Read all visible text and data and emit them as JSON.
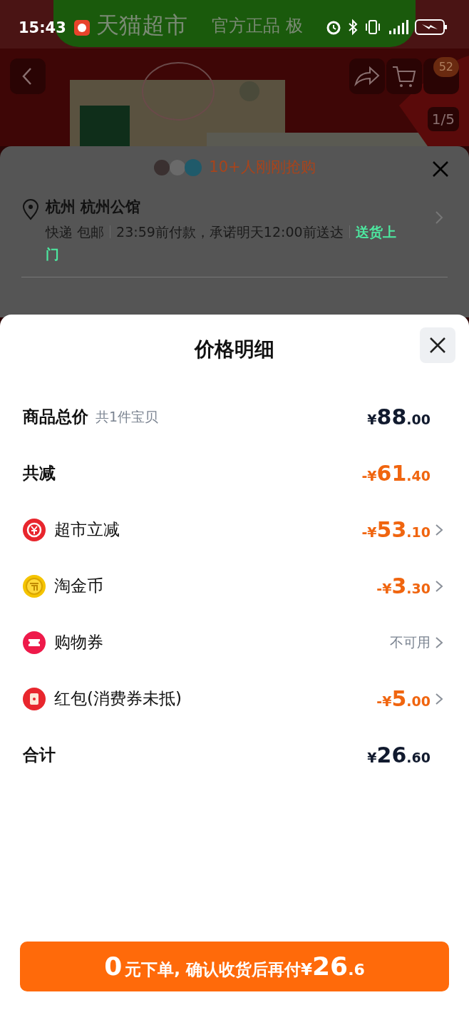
{
  "status_bar": {
    "time": "15:43"
  },
  "banner": {
    "brand": "天猫超市",
    "slogan": "官方正品 极"
  },
  "product_header": {
    "cart_badge": "52",
    "image_counter": "1/5"
  },
  "order_sheet": {
    "buyers_notice": "10+人刚刚抢购",
    "address": "杭州 杭州公馆",
    "delivery": [
      "快递 包邮",
      "23:59前付款，承诺明天12:00前送达"
    ],
    "delivery_service": "送货上门"
  },
  "price_sheet": {
    "title": "价格明细",
    "rows": [
      {
        "kind": "total",
        "label": "商品总价",
        "note": "共1件宝贝",
        "highlight": false,
        "has_arrow": false,
        "amount": {
          "prefix": "¥",
          "main": "88",
          "fraction": ".00"
        }
      },
      {
        "kind": "total",
        "label": "共减",
        "highlight": true,
        "has_arrow": false,
        "amount": {
          "prefix": "-¥",
          "main": "61",
          "fraction": ".40"
        }
      },
      {
        "kind": "discount",
        "label": "超市立减",
        "highlight": true,
        "has_arrow": true,
        "amount": {
          "prefix": "-¥",
          "main": "53",
          "fraction": ".10"
        }
      },
      {
        "kind": "coin",
        "label": "淘金币",
        "highlight": true,
        "has_arrow": true,
        "amount": {
          "prefix": "-¥",
          "main": "3",
          "fraction": ".30"
        }
      },
      {
        "kind": "coupon",
        "label": "购物券",
        "highlight": false,
        "has_arrow": true,
        "status": "不可用"
      },
      {
        "kind": "redpacket",
        "label": "红包(消费券未抵)",
        "highlight": true,
        "has_arrow": true,
        "amount": {
          "prefix": "-¥",
          "main": "5",
          "fraction": ".00"
        }
      },
      {
        "kind": "total",
        "label": "合计",
        "highlight": false,
        "has_arrow": false,
        "amount": {
          "prefix": "¥",
          "main": "26",
          "fraction": ".60"
        }
      }
    ]
  },
  "pay_button": {
    "lead": "0",
    "middle": "元下单, 确认收货后再付",
    "prefix": "¥",
    "main": "26",
    "fraction": ".6"
  }
}
